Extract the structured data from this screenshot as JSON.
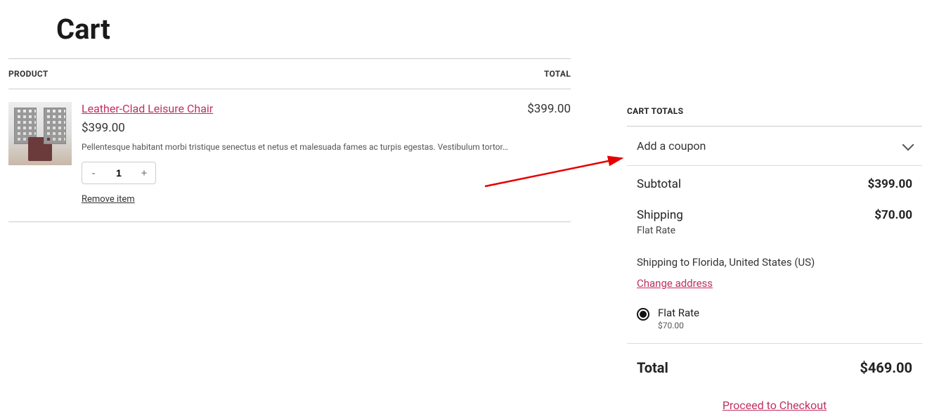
{
  "page": {
    "title": "Cart"
  },
  "table_headers": {
    "product": "PRODUCT",
    "total": "TOTAL"
  },
  "items": [
    {
      "name": "Leather-Clad Leisure Chair",
      "price": "$399.00",
      "line_total": "$399.00",
      "qty": "1",
      "desc": "Pellentesque habitant morbi tristique senectus et netus et malesuada fames ac turpis egestas. Vestibulum tortor…",
      "remove_label": "Remove item"
    }
  ],
  "qty_buttons": {
    "minus": "-",
    "plus": "+"
  },
  "sidebar": {
    "title": "CART TOTALS",
    "coupon_label": "Add a coupon",
    "subtotal_label": "Subtotal",
    "subtotal_value": "$399.00",
    "shipping_label": "Shipping",
    "shipping_value": "$70.00",
    "shipping_method": "Flat Rate",
    "shipping_to": "Shipping to Florida, United States (US)",
    "change_address": "Change address",
    "shipping_option": {
      "label": "Flat Rate",
      "price": "$70.00"
    },
    "total_label": "Total",
    "total_value": "$469.00",
    "proceed_label": "Proceed to Checkout"
  }
}
